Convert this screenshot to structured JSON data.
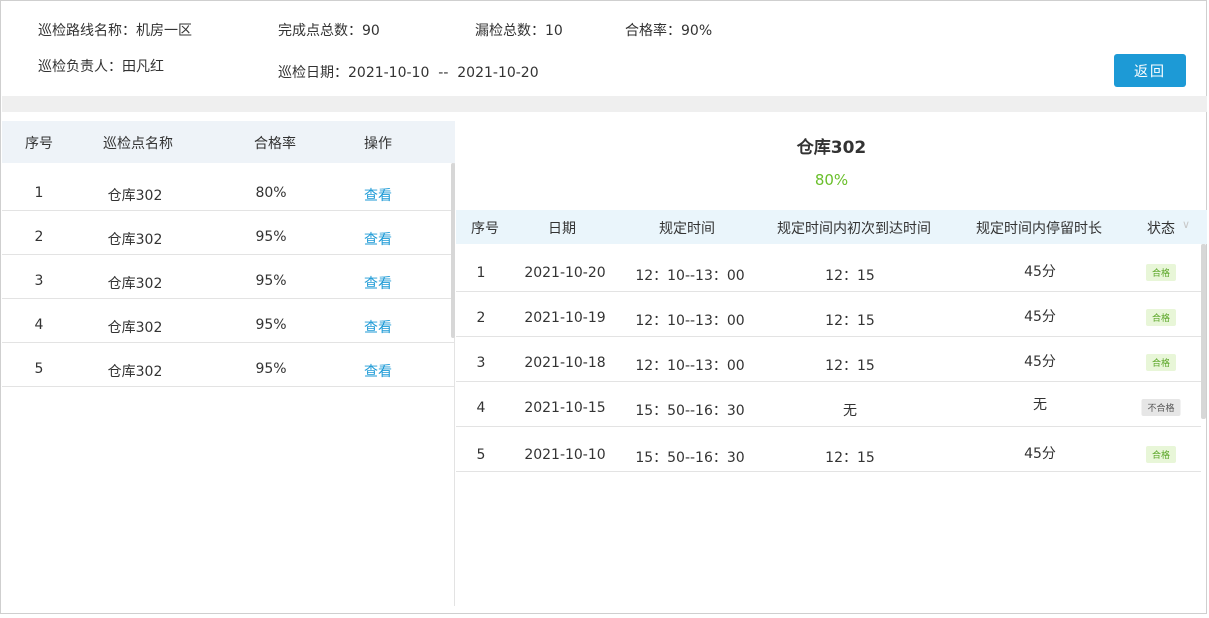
{
  "header": {
    "route_label": "巡检路线名称：机房一区",
    "done_label": "完成点总数：90",
    "missed_label": "漏检总数：10",
    "rate_label": "合格率：90%",
    "owner_label": "巡检负责人：田凡红",
    "date_label": "巡检日期：2021-10-10  --  2021-10-20",
    "back_button": "返回"
  },
  "left_table": {
    "columns": [
      "序号",
      "巡检点名称",
      "合格率",
      "操作"
    ],
    "rows": [
      {
        "no": "1",
        "name": "仓库302",
        "rate": "80%",
        "action": "查看"
      },
      {
        "no": "2",
        "name": "仓库302",
        "rate": "95%",
        "action": "查看"
      },
      {
        "no": "3",
        "name": "仓库302",
        "rate": "95%",
        "action": "查看"
      },
      {
        "no": "4",
        "name": "仓库302",
        "rate": "95%",
        "action": "查看"
      },
      {
        "no": "5",
        "name": "仓库302",
        "rate": "95%",
        "action": "查看"
      }
    ]
  },
  "detail": {
    "title": "仓库302",
    "rate": "80%",
    "columns": [
      "序号",
      "日期",
      "规定时间",
      "规定时间内初次到达时间",
      "规定时间内停留时长",
      "状态"
    ],
    "rows": [
      {
        "no": "1",
        "date": "2021-10-20",
        "window": "12：10--13：00",
        "arrive": "12：15",
        "stay": "45分",
        "status": "合格",
        "ok": true
      },
      {
        "no": "2",
        "date": "2021-10-19",
        "window": "12：10--13：00",
        "arrive": "12：15",
        "stay": "45分",
        "status": "合格",
        "ok": true
      },
      {
        "no": "3",
        "date": "2021-10-18",
        "window": "12：10--13：00",
        "arrive": "12：15",
        "stay": "45分",
        "status": "合格",
        "ok": true
      },
      {
        "no": "4",
        "date": "2021-10-15",
        "window": "15：50--16：30",
        "arrive": "无",
        "stay": "无",
        "status": "不合格",
        "ok": false
      },
      {
        "no": "5",
        "date": "2021-10-10",
        "window": "15：50--16：30",
        "arrive": "12：15",
        "stay": "45分",
        "status": "合格",
        "ok": true
      }
    ]
  },
  "colors": {
    "accent": "#1d9ad6",
    "pass_text": "#5aa627",
    "rate_green": "#6abf2b"
  }
}
